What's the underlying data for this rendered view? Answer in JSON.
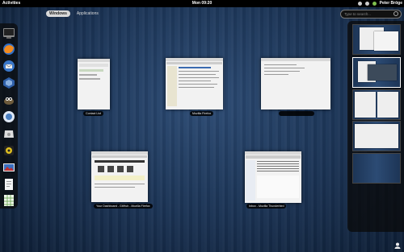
{
  "topbar": {
    "activities": "Activities",
    "clock": "Mon 09:20",
    "user": "Peter Bröge",
    "icons": [
      "network-icon",
      "volume-icon",
      "user-status-icon"
    ]
  },
  "tabs": [
    {
      "label": "Windows",
      "active": true
    },
    {
      "label": "Applications",
      "active": false
    }
  ],
  "search": {
    "placeholder": "Type to search..."
  },
  "dash": {
    "items": [
      "terminal-icon",
      "firefox-icon",
      "thunderbird-icon",
      "virtualbox-icon",
      "gimp-icon",
      "chat-icon",
      "disk-utility-icon",
      "rhythmbox-icon",
      "image-viewer-icon",
      "text-editor-icon",
      "spreadsheet-icon"
    ]
  },
  "windows": [
    {
      "caption": "Contact List"
    },
    {
      "caption": "Mozilla Firefox"
    },
    {
      "caption": ""
    },
    {
      "caption": "Your Dashboard - GitHub - Mozilla Firefox"
    },
    {
      "caption": "Inbox - Mozilla Thunderbird"
    }
  ],
  "workspaces": {
    "count": 5,
    "active_index": 1
  },
  "colors": {
    "accent": "#ffffff",
    "background": "#1d3556",
    "panel": "#000000"
  }
}
